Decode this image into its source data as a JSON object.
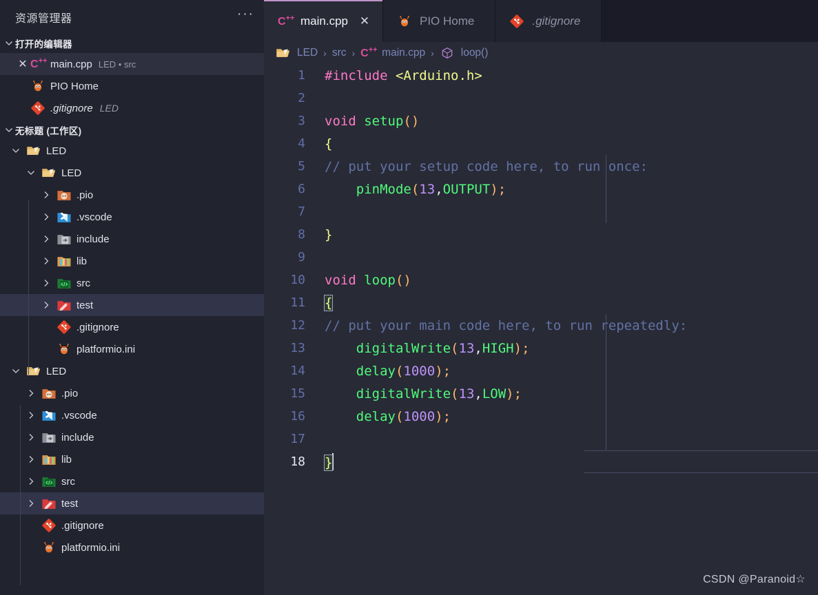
{
  "sidebar": {
    "title": "资源管理器",
    "more_actions": "···",
    "open_editors": {
      "header": "打开的编辑器",
      "items": [
        {
          "name": "main.cpp",
          "detail": "LED • src",
          "icon": "cpp-file-icon",
          "closable": true,
          "selected": true,
          "italic": false
        },
        {
          "name": "PIO Home",
          "detail": "",
          "icon": "platformio-ant-icon",
          "closable": false,
          "selected": false,
          "italic": false
        },
        {
          "name": ".gitignore",
          "detail": "LED",
          "icon": "git-file-icon",
          "closable": false,
          "selected": false,
          "italic": true
        }
      ]
    },
    "workspace": {
      "header": "无标题 (工作区)",
      "tree": [
        {
          "label": "LED",
          "icon": "folder-open-icon",
          "indent": 1,
          "expanded": true,
          "arrow": "down",
          "selected": false
        },
        {
          "label": "LED",
          "icon": "folder-open-icon",
          "indent": 2,
          "expanded": true,
          "arrow": "down",
          "selected": false
        },
        {
          "label": ".pio",
          "icon": "platformio-folder-icon",
          "indent": 3,
          "expanded": false,
          "arrow": "right",
          "selected": false
        },
        {
          "label": ".vscode",
          "icon": "vscode-folder-icon",
          "indent": 3,
          "expanded": false,
          "arrow": "right",
          "selected": false
        },
        {
          "label": "include",
          "icon": "include-folder-icon",
          "indent": 3,
          "expanded": false,
          "arrow": "right",
          "selected": false
        },
        {
          "label": "lib",
          "icon": "lib-folder-icon",
          "indent": 3,
          "expanded": false,
          "arrow": "right",
          "selected": false
        },
        {
          "label": "src",
          "icon": "src-folder-icon",
          "indent": 3,
          "expanded": false,
          "arrow": "right",
          "selected": false
        },
        {
          "label": "test",
          "icon": "test-folder-icon",
          "indent": 3,
          "expanded": false,
          "arrow": "right",
          "selected": true
        },
        {
          "label": ".gitignore",
          "icon": "git-file-icon",
          "indent": 3,
          "expanded": false,
          "arrow": "none",
          "selected": false
        },
        {
          "label": "platformio.ini",
          "icon": "platformio-ant-icon",
          "indent": 3,
          "expanded": false,
          "arrow": "none",
          "selected": false
        },
        {
          "label": "LED",
          "icon": "folder-open-icon",
          "indent": 1,
          "expanded": true,
          "arrow": "down",
          "selected": false
        },
        {
          "label": ".pio",
          "icon": "platformio-folder-icon",
          "indent": 2,
          "expanded": false,
          "arrow": "right",
          "selected": false
        },
        {
          "label": ".vscode",
          "icon": "vscode-folder-icon",
          "indent": 2,
          "expanded": false,
          "arrow": "right",
          "selected": false
        },
        {
          "label": "include",
          "icon": "include-folder-icon",
          "indent": 2,
          "expanded": false,
          "arrow": "right",
          "selected": false
        },
        {
          "label": "lib",
          "icon": "lib-folder-icon",
          "indent": 2,
          "expanded": false,
          "arrow": "right",
          "selected": false
        },
        {
          "label": "src",
          "icon": "src-folder-icon",
          "indent": 2,
          "expanded": false,
          "arrow": "right",
          "selected": false
        },
        {
          "label": "test",
          "icon": "test-folder-icon",
          "indent": 2,
          "expanded": false,
          "arrow": "right",
          "selected": true
        },
        {
          "label": ".gitignore",
          "icon": "git-file-icon",
          "indent": 2,
          "expanded": false,
          "arrow": "none",
          "selected": false
        },
        {
          "label": "platformio.ini",
          "icon": "platformio-ant-icon",
          "indent": 2,
          "expanded": false,
          "arrow": "none",
          "selected": false
        }
      ]
    }
  },
  "tabs": [
    {
      "label": "main.cpp",
      "icon": "cpp-file-icon",
      "active": true,
      "close": "✕",
      "italic": false
    },
    {
      "label": "PIO Home",
      "icon": "platformio-ant-icon",
      "active": false,
      "close": "",
      "italic": false
    },
    {
      "label": ".gitignore",
      "icon": "git-file-icon",
      "active": false,
      "close": "",
      "italic": true
    }
  ],
  "breadcrumb": {
    "separator": "›",
    "items": [
      {
        "label": "LED",
        "icon": "folder-open-icon"
      },
      {
        "label": "src",
        "icon": "none"
      },
      {
        "label": "main.cpp",
        "icon": "cpp-file-icon"
      },
      {
        "label": "loop()",
        "icon": "symbol-method-icon"
      }
    ]
  },
  "editor": {
    "language": "cpp",
    "current_line": 18,
    "line_numbers": [
      1,
      2,
      3,
      4,
      5,
      6,
      7,
      8,
      9,
      10,
      11,
      12,
      13,
      14,
      15,
      16,
      17,
      18
    ],
    "lines": [
      "#include <Arduino.h>",
      "",
      "void setup()",
      "{",
      "    // put your setup code here, to run once:",
      "    pinMode(13,OUTPUT);",
      "",
      "}",
      "",
      "void loop()",
      "{",
      "    // put your main code here, to run repeatedly:",
      "    digitalWrite(13,HIGH);",
      "    delay(1000);",
      "    digitalWrite(13,LOW);",
      "    delay(1000);",
      "",
      "}"
    ]
  },
  "watermark": "CSDN @Paranoid☆",
  "colors": {
    "editor_bg": "#282a36",
    "sidebar_bg": "#21232e",
    "tabbar_bg": "#1a1b26",
    "active_tab_border": "#bd93c9",
    "selection_bg": "#32354a",
    "line_number": "#636fa8",
    "comment": "#6272a4",
    "keyword": "#ff79c6",
    "function": "#50fa7b",
    "string": "#f1fa8c",
    "number": "#bd93f8",
    "paren": "#ffb86c"
  }
}
